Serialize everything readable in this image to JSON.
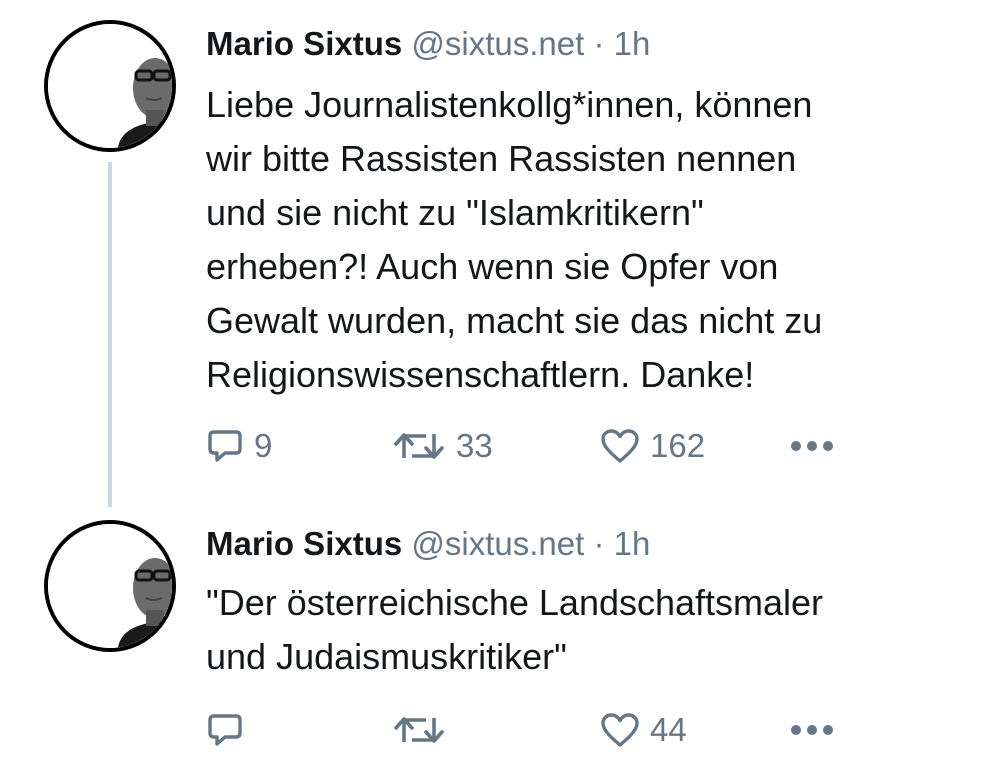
{
  "tweets": [
    {
      "author_name": "Mario Sixtus",
      "handle": "@sixtus.net",
      "separator": "·",
      "time": "1h",
      "text_lines": [
        "Liebe Journalistenkollg*innen, können",
        "wir bitte Rassisten Rassisten nennen",
        "und sie nicht zu \"Islamkritikern\"",
        "erheben?! Auch wenn sie Opfer von",
        "Gewalt wurden, macht sie das nicht zu",
        "Religionswissenschaftlern. Danke!"
      ],
      "reply_count": "9",
      "retweet_count": "33",
      "like_count": "162"
    },
    {
      "author_name": "Mario Sixtus",
      "handle": "@sixtus.net",
      "separator": "·",
      "time": "1h",
      "text_lines": [
        "\"Der österreichische Landschaftsmaler",
        "und Judaismuskritiker\""
      ],
      "reply_count": "",
      "retweet_count": "",
      "like_count": "44"
    }
  ],
  "icons": {
    "reply": "reply-icon",
    "retweet": "retweet-icon",
    "like": "heart-icon",
    "more": "more-dots-icon"
  },
  "colors": {
    "text": "#14171a",
    "secondary": "#657786",
    "thread_line": "#ccd6dd"
  }
}
